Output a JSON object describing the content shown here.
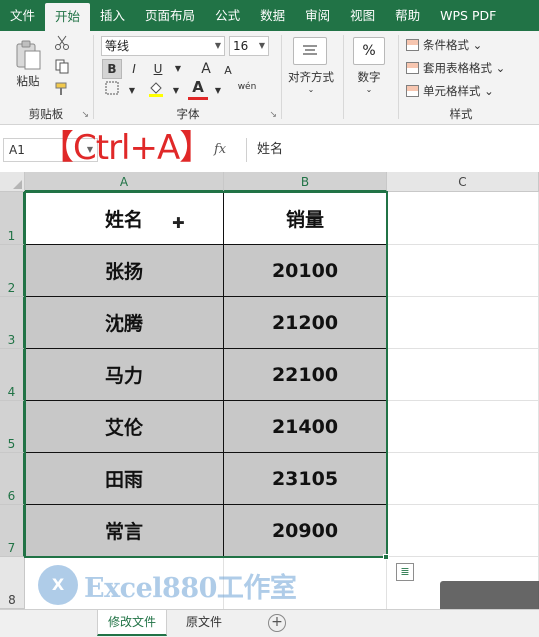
{
  "ribbon_tabs": [
    "文件",
    "开始",
    "插入",
    "页面布局",
    "公式",
    "数据",
    "审阅",
    "视图",
    "帮助",
    "WPS PDF"
  ],
  "ribbon": {
    "clipboard": {
      "label": "剪贴板",
      "paste": "粘贴"
    },
    "font": {
      "label": "字体",
      "name": "等线",
      "size": "16",
      "bold": "B",
      "italic": "I",
      "underline": "U",
      "grow": "A",
      "shrink": "A",
      "color_a": "A",
      "phonetic": "wén"
    },
    "alignment": {
      "label": "对齐方式"
    },
    "number": {
      "label": "数字",
      "symbol": "%"
    },
    "styles": {
      "label": "样式",
      "items": [
        "条件格式",
        "套用表格格式",
        "单元格样式"
      ]
    }
  },
  "formula_bar": {
    "name_box": "A1",
    "fx": "fx",
    "content": "姓名"
  },
  "hotkey_overlay": "【Ctrl+A】",
  "columns": [
    "A",
    "B",
    "C"
  ],
  "rows": [
    "1",
    "2",
    "3",
    "4",
    "5",
    "6",
    "7",
    "8"
  ],
  "table": {
    "headers": [
      "姓名",
      "销量"
    ],
    "rows": [
      [
        "张扬",
        "20100"
      ],
      [
        "沈腾",
        "21200"
      ],
      [
        "马力",
        "22100"
      ],
      [
        "艾伦",
        "21400"
      ],
      [
        "田雨",
        "23105"
      ],
      [
        "常言",
        "20900"
      ]
    ]
  },
  "watermark": {
    "logo": "X",
    "text": "Excel880工作室"
  },
  "sheets": [
    "修改文件",
    "原文件"
  ],
  "colors": {
    "excel_green": "#217346",
    "selection_fill": "#c8c8c8",
    "hotkey_red": "#e02828"
  }
}
